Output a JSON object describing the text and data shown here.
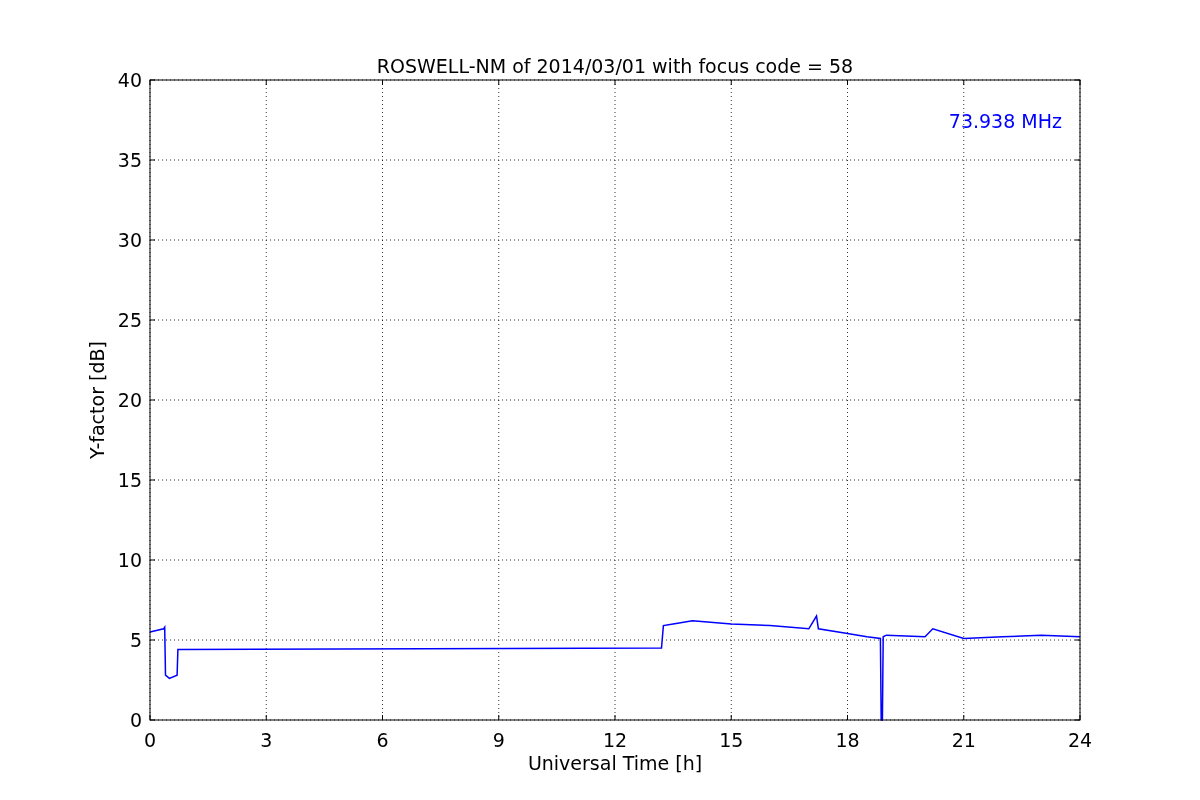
{
  "chart_data": {
    "type": "line",
    "title": "ROSWELL-NM of 2014/03/01 with focus code = 58",
    "xlabel": "Universal Time [h]",
    "ylabel": "Y-factor [dB]",
    "x": [
      0,
      0.35,
      0.38,
      0.4,
      0.5,
      0.7,
      0.72,
      0.75,
      13.2,
      13.25,
      13.5,
      14,
      15,
      16,
      17,
      17.2,
      17.25,
      18,
      18.5,
      18.85,
      18.87,
      18.9,
      18.92,
      19,
      20,
      20.2,
      21,
      22,
      23,
      24
    ],
    "series": [
      {
        "name": "73.938 MHz",
        "color": "#0000ff",
        "values": [
          5.5,
          5.7,
          5.8,
          2.8,
          2.6,
          2.8,
          4.4,
          4.4,
          4.5,
          5.9,
          6.0,
          6.2,
          6.0,
          5.9,
          5.7,
          6.5,
          5.7,
          5.4,
          5.2,
          5.1,
          0,
          0,
          5.2,
          5.3,
          5.2,
          5.7,
          5.1,
          5.2,
          5.3,
          5.2
        ]
      }
    ],
    "xlim": [
      0,
      24
    ],
    "ylim": [
      0,
      40
    ],
    "xticks": [
      0,
      3,
      6,
      9,
      12,
      15,
      18,
      21,
      24
    ],
    "yticks": [
      0,
      5,
      10,
      15,
      20,
      25,
      30,
      35,
      40
    ],
    "grid": true
  }
}
